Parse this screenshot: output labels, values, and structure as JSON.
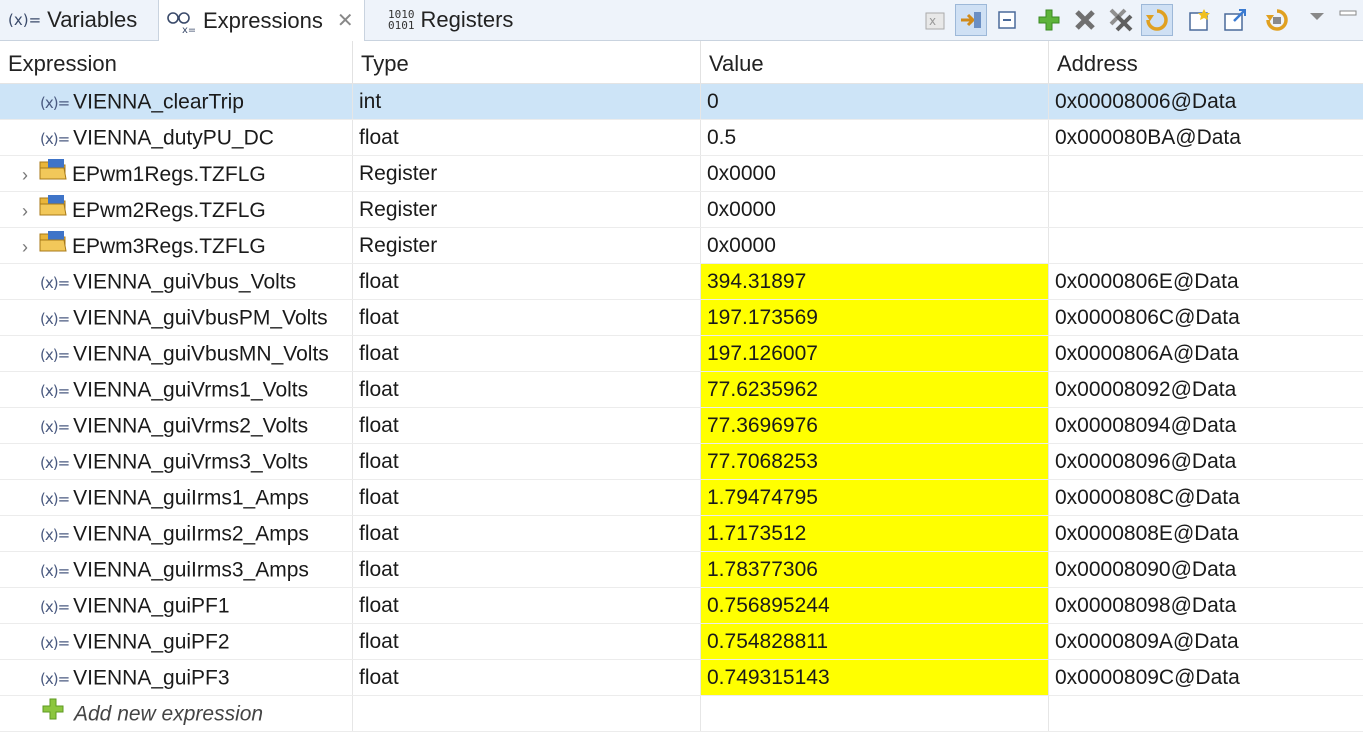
{
  "tabs": [
    {
      "label": "Variables",
      "icon": "variables-icon",
      "icon_glyph": "(x)="
    },
    {
      "label": "Expressions",
      "icon": "expressions-icon",
      "icon_glyph": "6ŏ"
    },
    {
      "label": "Registers",
      "icon": "registers-icon",
      "icon_glyph": "1010\n0101"
    }
  ],
  "toolbar": {
    "icons": [
      "show-type-names-icon",
      "link-with-debug-view-icon",
      "collapse-all-icon",
      "add-expression-icon",
      "remove-icon",
      "remove-all-icon",
      "refresh-icon",
      "new-group-icon",
      "export-icon",
      "continuous-refresh-icon",
      "view-menu-icon",
      "minimize-icon"
    ]
  },
  "columns": [
    "Expression",
    "Type",
    "Value",
    "Address"
  ],
  "rows": [
    {
      "kind": "var",
      "expression": "VIENNA_clearTrip",
      "type": "int",
      "value": "0",
      "address": "0x00008006@Data",
      "changed": false,
      "selected": true
    },
    {
      "kind": "var",
      "expression": "VIENNA_dutyPU_DC",
      "type": "float",
      "value": "0.5",
      "address": "0x000080BA@Data",
      "changed": false
    },
    {
      "kind": "reg",
      "expression": "EPwm1Regs.TZFLG",
      "type": "Register",
      "value": "0x0000",
      "address": "",
      "changed": false
    },
    {
      "kind": "reg",
      "expression": "EPwm2Regs.TZFLG",
      "type": "Register",
      "value": "0x0000",
      "address": "",
      "changed": false
    },
    {
      "kind": "reg",
      "expression": "EPwm3Regs.TZFLG",
      "type": "Register",
      "value": "0x0000",
      "address": "",
      "changed": false
    },
    {
      "kind": "var",
      "expression": "VIENNA_guiVbus_Volts",
      "type": "float",
      "value": "394.31897",
      "address": "0x0000806E@Data",
      "changed": true
    },
    {
      "kind": "var",
      "expression": "VIENNA_guiVbusPM_Volts",
      "type": "float",
      "value": "197.173569",
      "address": "0x0000806C@Data",
      "changed": true
    },
    {
      "kind": "var",
      "expression": "VIENNA_guiVbusMN_Volts",
      "type": "float",
      "value": "197.126007",
      "address": "0x0000806A@Data",
      "changed": true
    },
    {
      "kind": "var",
      "expression": "VIENNA_guiVrms1_Volts",
      "type": "float",
      "value": "77.6235962",
      "address": "0x00008092@Data",
      "changed": true
    },
    {
      "kind": "var",
      "expression": "VIENNA_guiVrms2_Volts",
      "type": "float",
      "value": "77.3696976",
      "address": "0x00008094@Data",
      "changed": true
    },
    {
      "kind": "var",
      "expression": "VIENNA_guiVrms3_Volts",
      "type": "float",
      "value": "77.7068253",
      "address": "0x00008096@Data",
      "changed": true
    },
    {
      "kind": "var",
      "expression": "VIENNA_guiIrms1_Amps",
      "type": "float",
      "value": "1.79474795",
      "address": "0x0000808C@Data",
      "changed": true
    },
    {
      "kind": "var",
      "expression": "VIENNA_guiIrms2_Amps",
      "type": "float",
      "value": "1.7173512",
      "address": "0x0000808E@Data",
      "changed": true
    },
    {
      "kind": "var",
      "expression": "VIENNA_guiIrms3_Amps",
      "type": "float",
      "value": "1.78377306",
      "address": "0x00008090@Data",
      "changed": true
    },
    {
      "kind": "var",
      "expression": "VIENNA_guiPF1",
      "type": "float",
      "value": "0.756895244",
      "address": "0x00008098@Data",
      "changed": true
    },
    {
      "kind": "var",
      "expression": "VIENNA_guiPF2",
      "type": "float",
      "value": "0.754828811",
      "address": "0x0000809A@Data",
      "changed": true
    },
    {
      "kind": "var",
      "expression": "VIENNA_guiPF3",
      "type": "float",
      "value": "0.749315143",
      "address": "0x0000809C@Data",
      "changed": true
    }
  ],
  "add_row": {
    "label": "Add new expression"
  },
  "colors": {
    "changed_value": "#ffff00",
    "selected_row": "#cde4f7",
    "tabbar": "#eef3fa"
  }
}
